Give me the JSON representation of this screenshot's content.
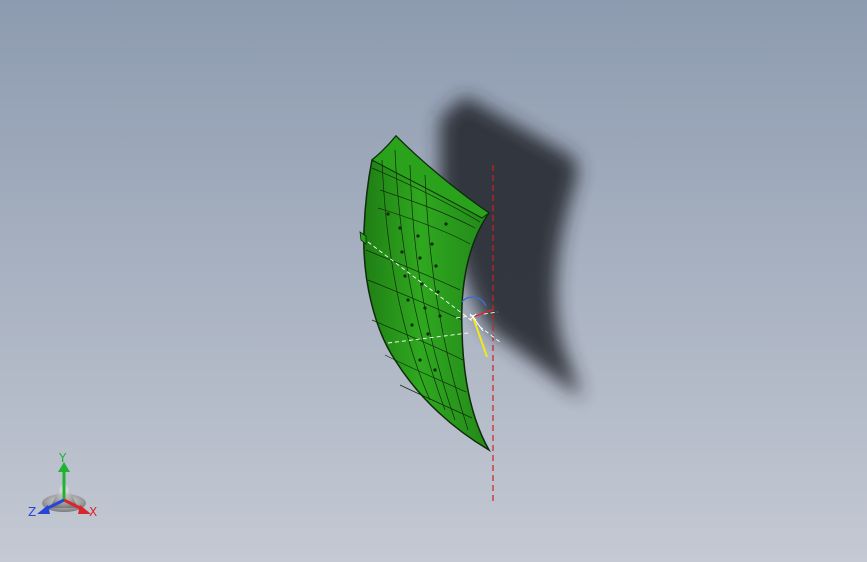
{
  "viewport": {
    "background_top": "#8d9bb0",
    "background_bottom": "#c4c9d3",
    "part_color": "#2a9a1c",
    "part_edge_color": "#0f2a0c",
    "shadow_color": "#262b31",
    "section_line_color": "#d21f1f"
  },
  "triad": {
    "x_label": "X",
    "y_label": "Y",
    "z_label": "Z",
    "x_color": "#d9262d",
    "y_color": "#1fb233",
    "z_color": "#2746d6"
  }
}
